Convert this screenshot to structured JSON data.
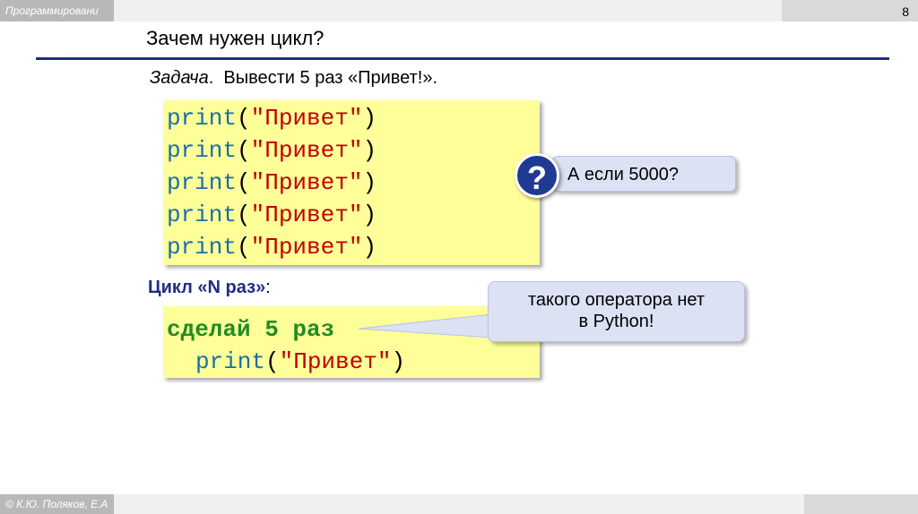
{
  "header": {
    "course": "Программировани",
    "slide_number": "8"
  },
  "title": "Зачем нужен цикл?",
  "task": {
    "label": "Задача",
    "label_dot": ".",
    "text": "Вывести 5 раз «Привет!»."
  },
  "code1": {
    "lines": [
      {
        "kw": "print",
        "open": "(",
        "str": "\"Привет\"",
        "close": ")"
      },
      {
        "kw": "print",
        "open": "(",
        "str": "\"Привет\"",
        "close": ")"
      },
      {
        "kw": "print",
        "open": "(",
        "str": "\"Привет\"",
        "close": ")"
      },
      {
        "kw": "print",
        "open": "(",
        "str": "\"Привет\"",
        "close": ")"
      },
      {
        "kw": "print",
        "open": "(",
        "str": "\"Привет\"",
        "close": ")"
      }
    ]
  },
  "question_callout": {
    "icon_text": "?",
    "text": "А если 5000?",
    "icon": "question-icon"
  },
  "cycle": {
    "title_bold": "Цикл «N раз»",
    "title_colon": ":"
  },
  "code2": {
    "line1": "сделай 5 раз",
    "line2": {
      "kw": "print",
      "open": "(",
      "str": "\"Привет\"",
      "close": ")"
    }
  },
  "note_callout": {
    "line1": "такого оператора нет",
    "line2": "в Python!"
  },
  "footer": {
    "author": "© К.Ю. Поляков, Е.А"
  },
  "colors": {
    "accent": "#1f2d86",
    "code_bg": "#ffff99",
    "keyword": "#1a6ea8",
    "string": "#c00000",
    "keyword_green": "#238c23",
    "callout_bg": "#dce1f4"
  }
}
